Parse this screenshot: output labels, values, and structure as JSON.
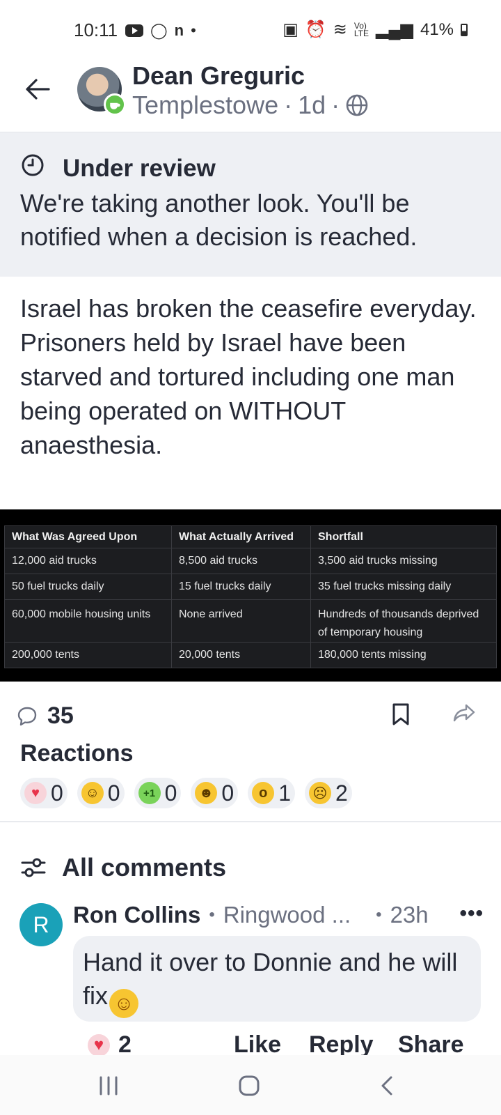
{
  "status_bar": {
    "time": "10:11",
    "battery": "41%"
  },
  "post": {
    "author": "Dean Greguric",
    "location": "Templestowe",
    "age": "1d",
    "separator": "·"
  },
  "review": {
    "title": "Under review",
    "text": "We're taking another look. You'll be notified when a decision is reached."
  },
  "body_lines": [
    "Israel has broken the ceasefire everyday.",
    "Prisoners held by Israel have been starved and tortured including one man being operated on WITHOUT anaesthesia."
  ],
  "table": {
    "headers": [
      "What Was Agreed Upon",
      "What Actually Arrived",
      "Shortfall"
    ],
    "rows": [
      [
        "12,000 aid trucks",
        "8,500 aid trucks",
        "3,500 aid trucks missing"
      ],
      [
        "50 fuel trucks daily",
        "15 fuel trucks daily",
        "35 fuel trucks missing daily"
      ],
      [
        "60,000 mobile housing units",
        "None arrived",
        "Hundreds of thousands deprived of temporary housing"
      ],
      [
        "200,000 tents",
        "20,000 tents",
        "180,000 tents missing"
      ]
    ]
  },
  "actions": {
    "comment_count": "35"
  },
  "reactions": {
    "title": "Reactions",
    "items": [
      {
        "icon": "heart-icon",
        "count": "0",
        "color": "#e8334a"
      },
      {
        "icon": "smile-icon",
        "count": "0",
        "color": "#f7c531"
      },
      {
        "icon": "plus-one-icon",
        "count": "0",
        "color": "#7ad35a"
      },
      {
        "icon": "laugh-icon",
        "count": "0",
        "color": "#f7c531"
      },
      {
        "icon": "wow-icon",
        "count": "1",
        "color": "#f7c531"
      },
      {
        "icon": "sad-icon",
        "count": "2",
        "color": "#f7c531"
      }
    ]
  },
  "comments": {
    "title": "All comments",
    "items": [
      {
        "initial": "R",
        "name": "Ron Collins",
        "location": "Ringwood ...",
        "time": "23h",
        "text": "Hand it over to Donnie and he will fix",
        "reaction_count": "2",
        "like": "Like",
        "reply": "Reply",
        "share": "Share"
      }
    ]
  }
}
